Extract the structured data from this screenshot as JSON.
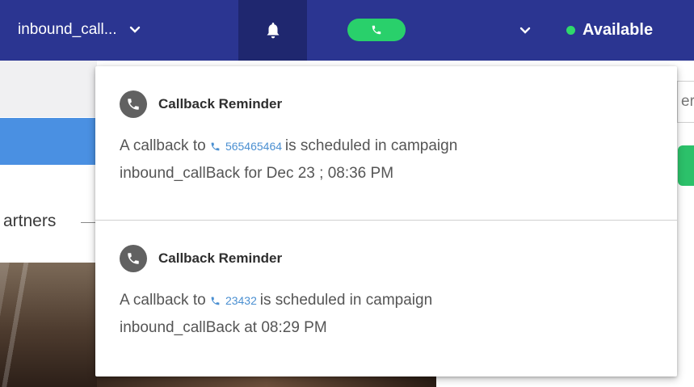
{
  "header": {
    "campaign_label": "inbound_call...",
    "status_label": "Available",
    "colors": {
      "bar": "#2b3591",
      "bell_bg": "#1f276f",
      "call": "#29d06b",
      "status_dot": "#2fd96b"
    },
    "icons": [
      "chevron-down-icon",
      "bell-icon",
      "phone-icon"
    ]
  },
  "background": {
    "partners_text": "artners",
    "input_fragment": "er"
  },
  "notifications": [
    {
      "title": "Callback Reminder",
      "prefix": "A callback to",
      "phone": "565465464",
      "middle": "is scheduled in campaign",
      "suffix": "inbound_callBack for Dec 23 ; 08:36 PM"
    },
    {
      "title": "Callback Reminder",
      "prefix": "A callback to",
      "phone": "23432",
      "middle": "is scheduled in campaign",
      "suffix": "inbound_callBack at 08:29 PM"
    }
  ]
}
